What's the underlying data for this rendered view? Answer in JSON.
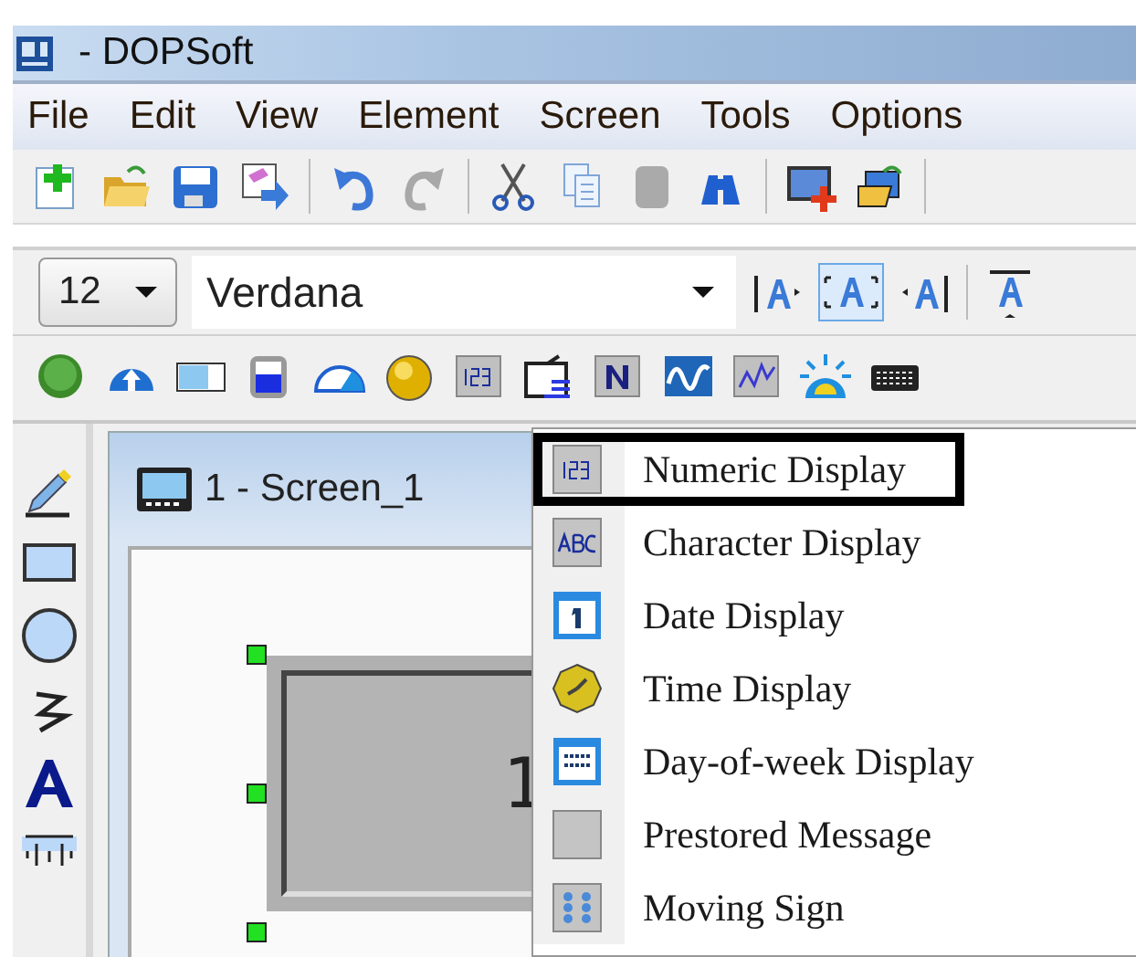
{
  "window": {
    "title": "- DOPSoft"
  },
  "menu_bar": [
    "File",
    "Edit",
    "View",
    "Element",
    "Screen",
    "Tools",
    "Options"
  ],
  "format_toolbar": {
    "font_size": "12",
    "font_name": "Verdana"
  },
  "screen_window": {
    "title": "1 - Screen_1",
    "element_text": "1"
  },
  "popup_menu": {
    "items": [
      {
        "label": "Numeric Display",
        "selected": true
      },
      {
        "label": "Character Display",
        "selected": false
      },
      {
        "label": "Date Display",
        "selected": false
      },
      {
        "label": "Time Display",
        "selected": false
      },
      {
        "label": "Day-of-week Display",
        "selected": false
      },
      {
        "label": "Prestored Message",
        "selected": false
      },
      {
        "label": "Moving Sign",
        "selected": false
      }
    ]
  }
}
